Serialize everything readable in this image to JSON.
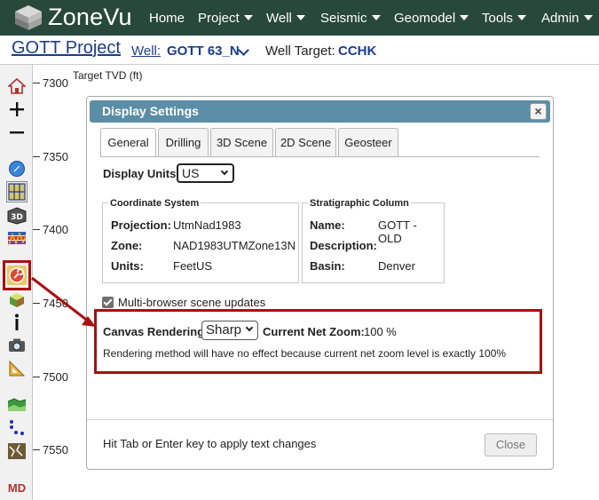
{
  "nav": {
    "brand": "ZoneVu",
    "items": [
      {
        "label": "Home",
        "dropdown": false
      },
      {
        "label": "Project",
        "dropdown": true
      },
      {
        "label": "Well",
        "dropdown": true
      },
      {
        "label": "Seismic",
        "dropdown": true
      },
      {
        "label": "Geomodel",
        "dropdown": true
      },
      {
        "label": "Tools",
        "dropdown": true
      },
      {
        "label": "Admin",
        "dropdown": true
      }
    ]
  },
  "header": {
    "project_title": "GOTT Project",
    "well_label": "Well:",
    "well_value": "GOTT 63_N",
    "target_label": "Well Target:",
    "target_value": "CCHK"
  },
  "toolbar": {
    "icons": [
      "home-icon",
      "zoom-in-icon",
      "zoom-out-icon",
      "compass-icon",
      "grid-icon",
      "3d-view-icon",
      "layers-icon",
      "display-settings-icon",
      "cube-icon",
      "info-icon",
      "camera-icon",
      "ruler-icon",
      "surface-icon",
      "points-icon",
      "faults-icon",
      "md-icon"
    ],
    "md_label": "MD"
  },
  "ruler": {
    "title": "Target TVD (ft)",
    "ticks": [
      "7300",
      "7350",
      "7400",
      "7450",
      "7500",
      "7550"
    ]
  },
  "dialog": {
    "title": "Display Settings",
    "close_glyph": "×",
    "tabs": [
      "General",
      "Drilling",
      "3D Scene",
      "2D Scene",
      "Geosteer"
    ],
    "active_tab": "General",
    "display_units_label": "Display Units:",
    "display_units_value": "US",
    "coord": {
      "legend": "Coordinate System",
      "projection_label": "Projection:",
      "projection_value": "UtmNad1983",
      "zone_label": "Zone:",
      "zone_value": "NAD1983UTMZone13N",
      "units_label": "Units:",
      "units_value": "FeetUS"
    },
    "strat": {
      "legend": "Stratigraphic Column",
      "name_label": "Name:",
      "name_value": "GOTT - OLD",
      "description_label": "Description:",
      "description_value": "",
      "basin_label": "Basin:",
      "basin_value": "Denver"
    },
    "multi_browser_label": "Multi-browser scene updates",
    "multi_browser_checked": true,
    "canvas_rendering_label": "Canvas Rendering:",
    "canvas_rendering_value": "Sharp",
    "net_zoom_label": "Current Net Zoom:",
    "net_zoom_value": "100 %",
    "rendering_note": "Rendering method will have no effect because current net zoom level is exactly 100%",
    "hint": "Hit Tab or Enter key to apply text changes",
    "close_label": "Close"
  },
  "colors": {
    "nav_bg": "#28483b",
    "title_bar": "#5b8ea6",
    "link_blue": "#1e3c8c",
    "highlight_red": "#a80f0f"
  }
}
